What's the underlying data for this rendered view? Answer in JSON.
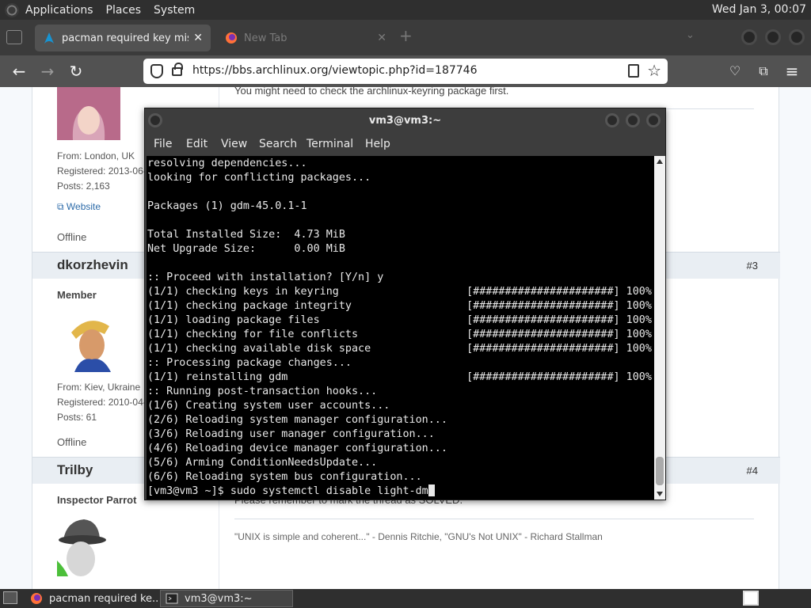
{
  "top_panel": {
    "menus": [
      "Applications",
      "Places",
      "System"
    ],
    "clock": "Wed Jan  3, 00:07"
  },
  "browser": {
    "tabs": [
      {
        "title": "pacman required key missing",
        "active": true
      },
      {
        "title": "New Tab",
        "active": false
      }
    ],
    "new_tab_symbol": "+",
    "url": "https://bbs.archlinux.org/viewtopic.php?id=187746"
  },
  "forum": {
    "top_text": "You might need to check the archlinux-keyring package first.",
    "post1": {
      "from": "From: London, UK",
      "registered": "Registered: 2013-06-",
      "posts": "Posts: 2,163",
      "website": "Website",
      "status": "Offline"
    },
    "post2": {
      "author": "dkorzhevin",
      "number": "#3",
      "title": "Member",
      "from": "From: Kiev, Ukraine",
      "registered": "Registered: 2010-04-",
      "posts": "Posts: 61",
      "status": "Offline"
    },
    "post3": {
      "author": "Trilby",
      "number": "#4",
      "title": "Inspector Parrot",
      "text": "Please remember to mark the thread as SOLVED.",
      "signature": "\"UNIX is simple and coherent...\" - Dennis Ritchie, \"GNU's Not UNIX\" -  Richard Stallman"
    }
  },
  "terminal": {
    "title": "vm3@vm3:~",
    "menus": [
      "File",
      "Edit",
      "View",
      "Search",
      "Terminal",
      "Help"
    ],
    "lines": [
      "resolving dependencies...",
      "looking for conflicting packages...",
      "",
      "Packages (1) gdm-45.0.1-1",
      "",
      "Total Installed Size:  4.73 MiB",
      "Net Upgrade Size:      0.00 MiB",
      "",
      ":: Proceed with installation? [Y/n] y",
      "(1/1) checking keys in keyring                    [######################] 100%",
      "(1/1) checking package integrity                  [######################] 100%",
      "(1/1) loading package files                       [######################] 100%",
      "(1/1) checking for file conflicts                 [######################] 100%",
      "(1/1) checking available disk space               [######################] 100%",
      ":: Processing package changes...",
      "(1/1) reinstalling gdm                            [######################] 100%",
      ":: Running post-transaction hooks...",
      "(1/6) Creating system user accounts...",
      "(2/6) Reloading system manager configuration...",
      "(3/6) Reloading user manager configuration...",
      "(4/6) Reloading device manager configuration...",
      "(5/6) Arming ConditionNeedsUpdate...",
      "(6/6) Reloading system bus configuration..."
    ],
    "prompt": "[vm3@vm3 ~]$ ",
    "command": "sudo systemctl disable light-dm"
  },
  "taskbar": {
    "tasks": [
      "pacman required ke...",
      "vm3@vm3:~"
    ]
  },
  "colors": {
    "firefox_orange": "#ff7139",
    "arch_blue": "#1793d1",
    "terminal_bg": "#000000"
  }
}
